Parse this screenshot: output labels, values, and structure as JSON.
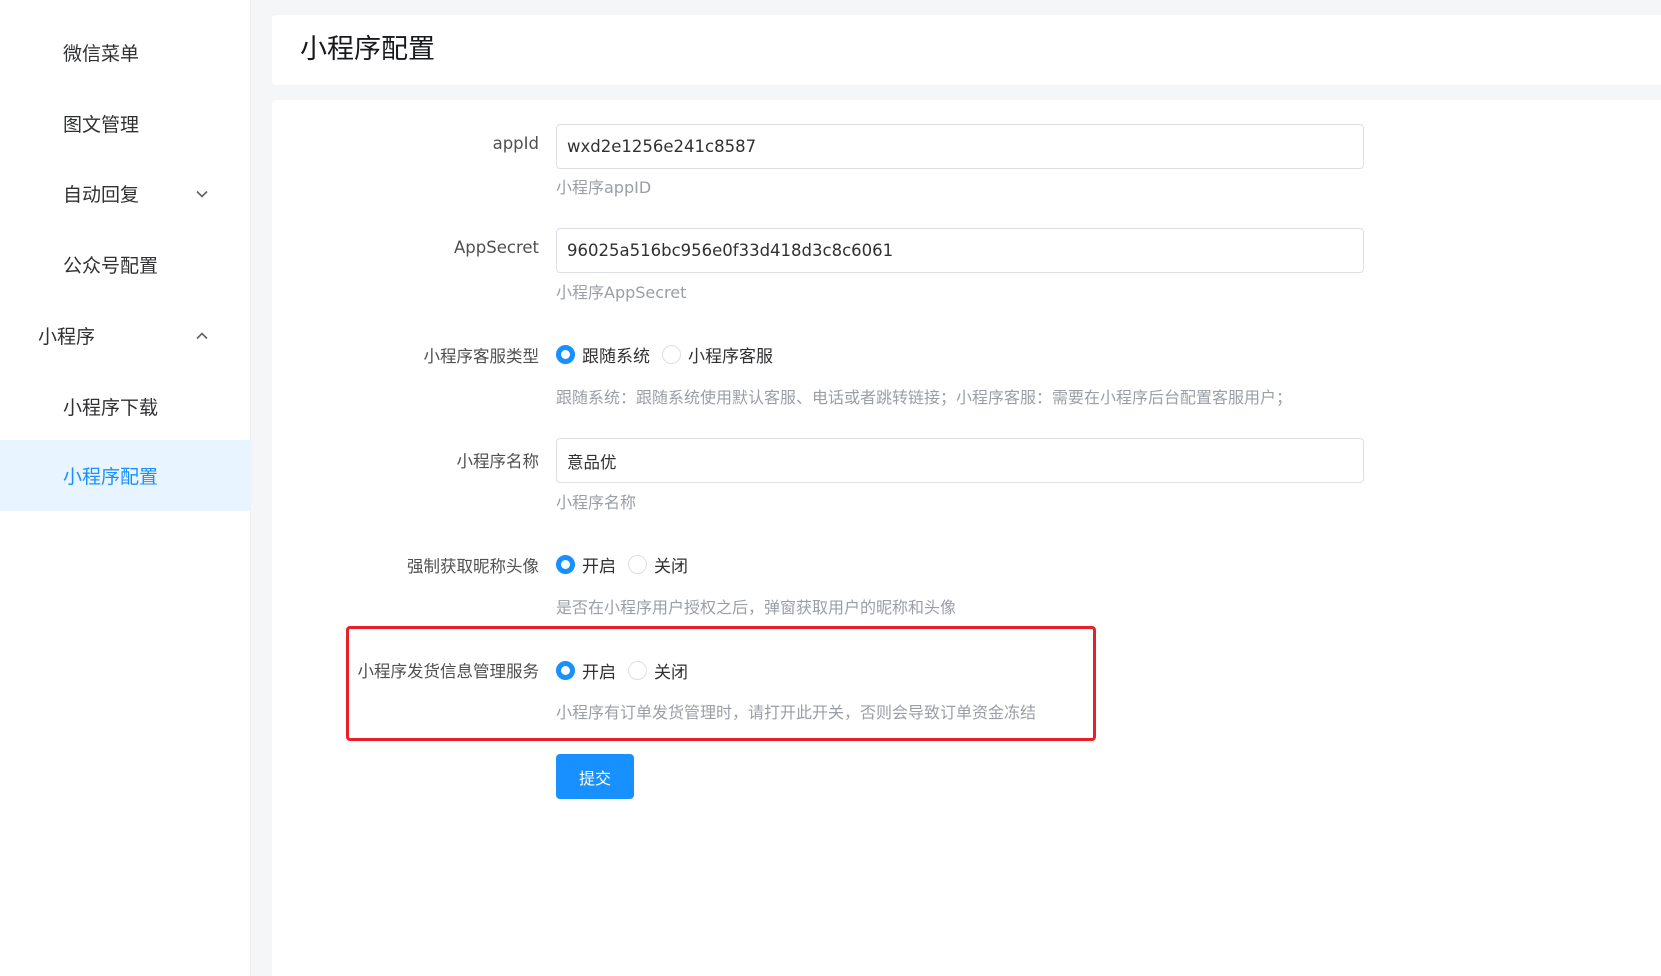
{
  "sidebar": {
    "items": [
      {
        "label": "微信菜单"
      },
      {
        "label": "图文管理"
      },
      {
        "label": "自动回复"
      },
      {
        "label": "公众号配置"
      },
      {
        "label": "小程序"
      },
      {
        "label": "小程序下载"
      },
      {
        "label": "小程序配置"
      }
    ]
  },
  "header": {
    "title": "小程序配置"
  },
  "form": {
    "app_id": {
      "label": "appId",
      "value": "wxd2e1256e241c8587",
      "hint": "小程序appID"
    },
    "app_secret": {
      "label": "AppSecret",
      "value": "96025a516bc956e0f33d418d3c8c6061",
      "hint": "小程序AppSecret"
    },
    "service_type": {
      "label": "小程序客服类型",
      "options": [
        "跟随系统",
        "小程序客服"
      ],
      "selected": "跟随系统",
      "hint": "跟随系统：跟随系统使用默认客服、电话或者跳转链接；小程序客服：需要在小程序后台配置客服用户；"
    },
    "app_name": {
      "label": "小程序名称",
      "value": "意品优",
      "hint": "小程序名称"
    },
    "force_profile": {
      "label": "强制获取昵称头像",
      "options": [
        "开启",
        "关闭"
      ],
      "selected": "开启",
      "hint": "是否在小程序用户授权之后，弹窗获取用户的昵称和头像"
    },
    "shipping_service": {
      "label": "小程序发货信息管理服务",
      "options": [
        "开启",
        "关闭"
      ],
      "selected": "开启",
      "hint": "小程序有订单发货管理时，请打开此开关，否则会导致订单资金冻结"
    },
    "submit_label": "提交"
  },
  "colors": {
    "accent": "#1890ff",
    "highlight": "#e8202a",
    "active_bg": "#e8f4ff"
  }
}
